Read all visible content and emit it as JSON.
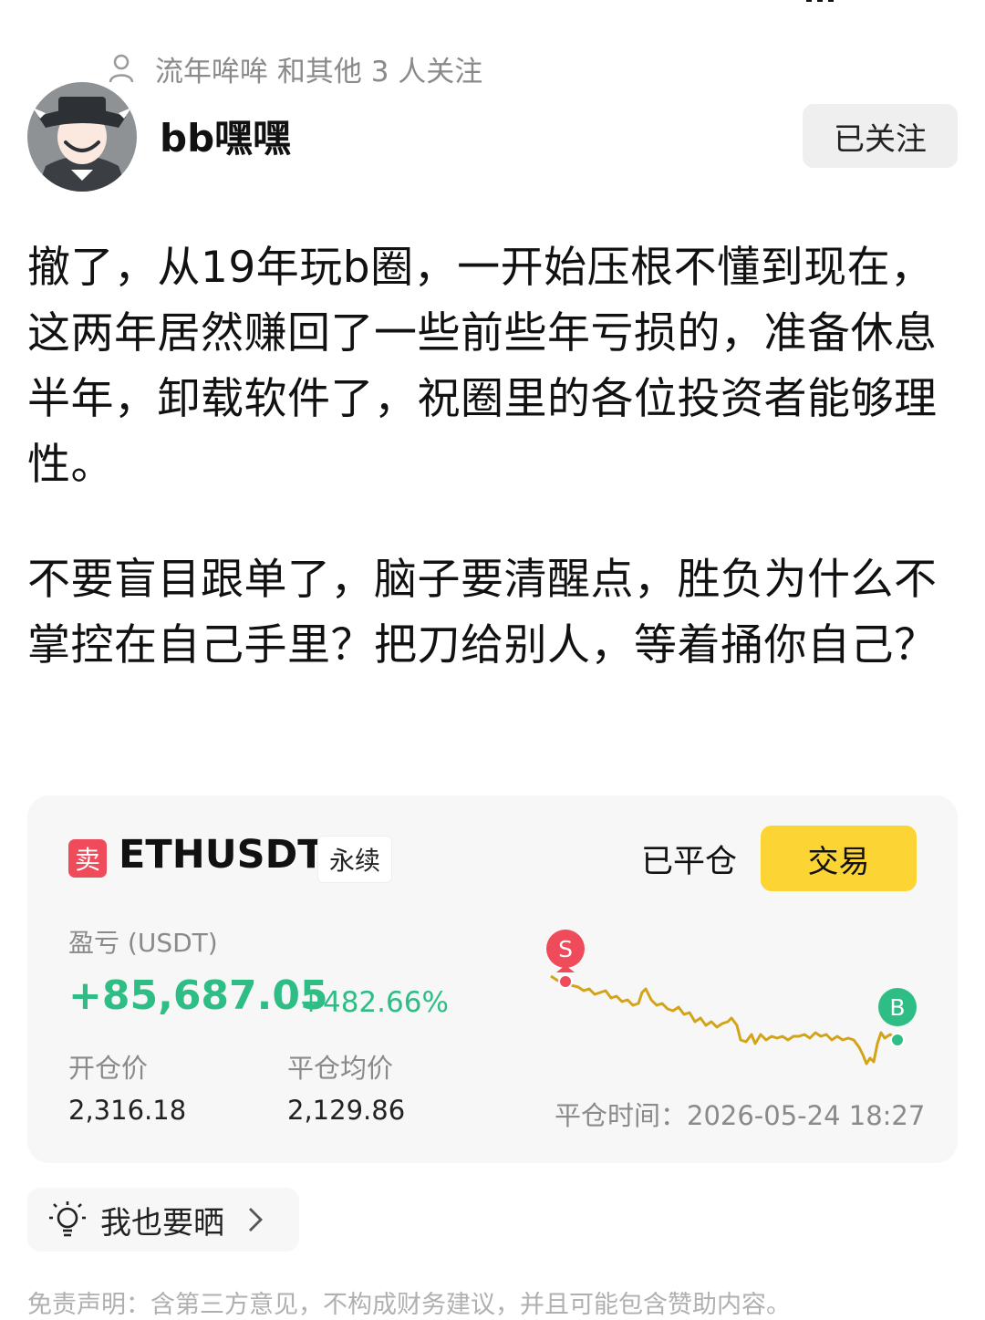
{
  "header": {
    "followed_by": "流年哞哞 和其他 3 人关注",
    "username": "bb嘿嘿",
    "follow_button": "已关注"
  },
  "post": {
    "paragraphs": [
      "撤了，从19年玩b圈，一开始压根不懂到现在，这两年居然赚回了一些前些年亏损的，准备休息半年，卸载软件了，祝圈里的各位投资者能够理性。",
      "不要盲目跟单了，脑子要清醒点，胜负为什么不掌控在自己手里？把刀给别人，等着捅你自己？"
    ]
  },
  "trade_card": {
    "side_tag": "卖",
    "symbol": "ETHUSDT",
    "contract_type": "永续",
    "status": "已平仓",
    "trade_button": "交易",
    "pnl_label": "盈亏 (USDT)",
    "pnl_value": "+85,687.05",
    "pnl_percent": "+482.66%",
    "open_price_label": "开仓价",
    "open_price": "2,316.18",
    "close_price_label": "平仓均价",
    "close_price": "2,129.86",
    "close_time": "平仓时间：2026-05-24 18:27",
    "sell_marker": "S",
    "buy_marker": "B",
    "colors": {
      "sell": "#ef4b5a",
      "buy": "#2ebd85",
      "line": "#d4a418",
      "trade_button": "#fcd535"
    }
  },
  "share": {
    "label": "我也要晒",
    "icon": "lightbulb-icon"
  },
  "disclaimer": "免责声明：含第三方意见，不构成财务建议，并且可能包含赞助内容。"
}
